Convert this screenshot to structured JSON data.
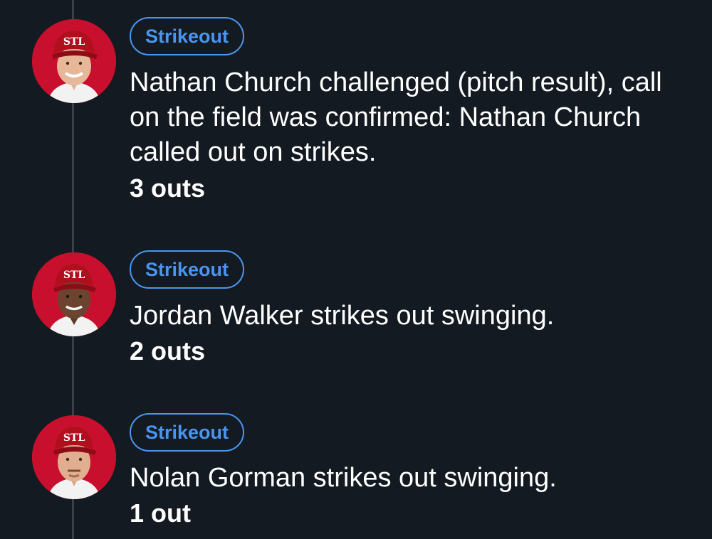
{
  "plays": [
    {
      "badge": "Strikeout",
      "description": "Nathan Church challenged (pitch result), call on the field was confirmed: Nathan Church called out on strikes.",
      "outs": "3 outs",
      "avatar_icon": "player-headshot-icon",
      "cap_logo": "STL"
    },
    {
      "badge": "Strikeout",
      "description": "Jordan Walker strikes out swinging.",
      "outs": "2 outs",
      "avatar_icon": "player-headshot-icon",
      "cap_logo": "STL"
    },
    {
      "badge": "Strikeout",
      "description": "Nolan Gorman strikes out swinging.",
      "outs": "1 out",
      "avatar_icon": "player-headshot-icon",
      "cap_logo": "STL"
    }
  ],
  "colors": {
    "background": "#141a21",
    "badge_accent": "#4a95f0",
    "timeline": "#3a4049",
    "avatar_bg": "#c8102e"
  }
}
